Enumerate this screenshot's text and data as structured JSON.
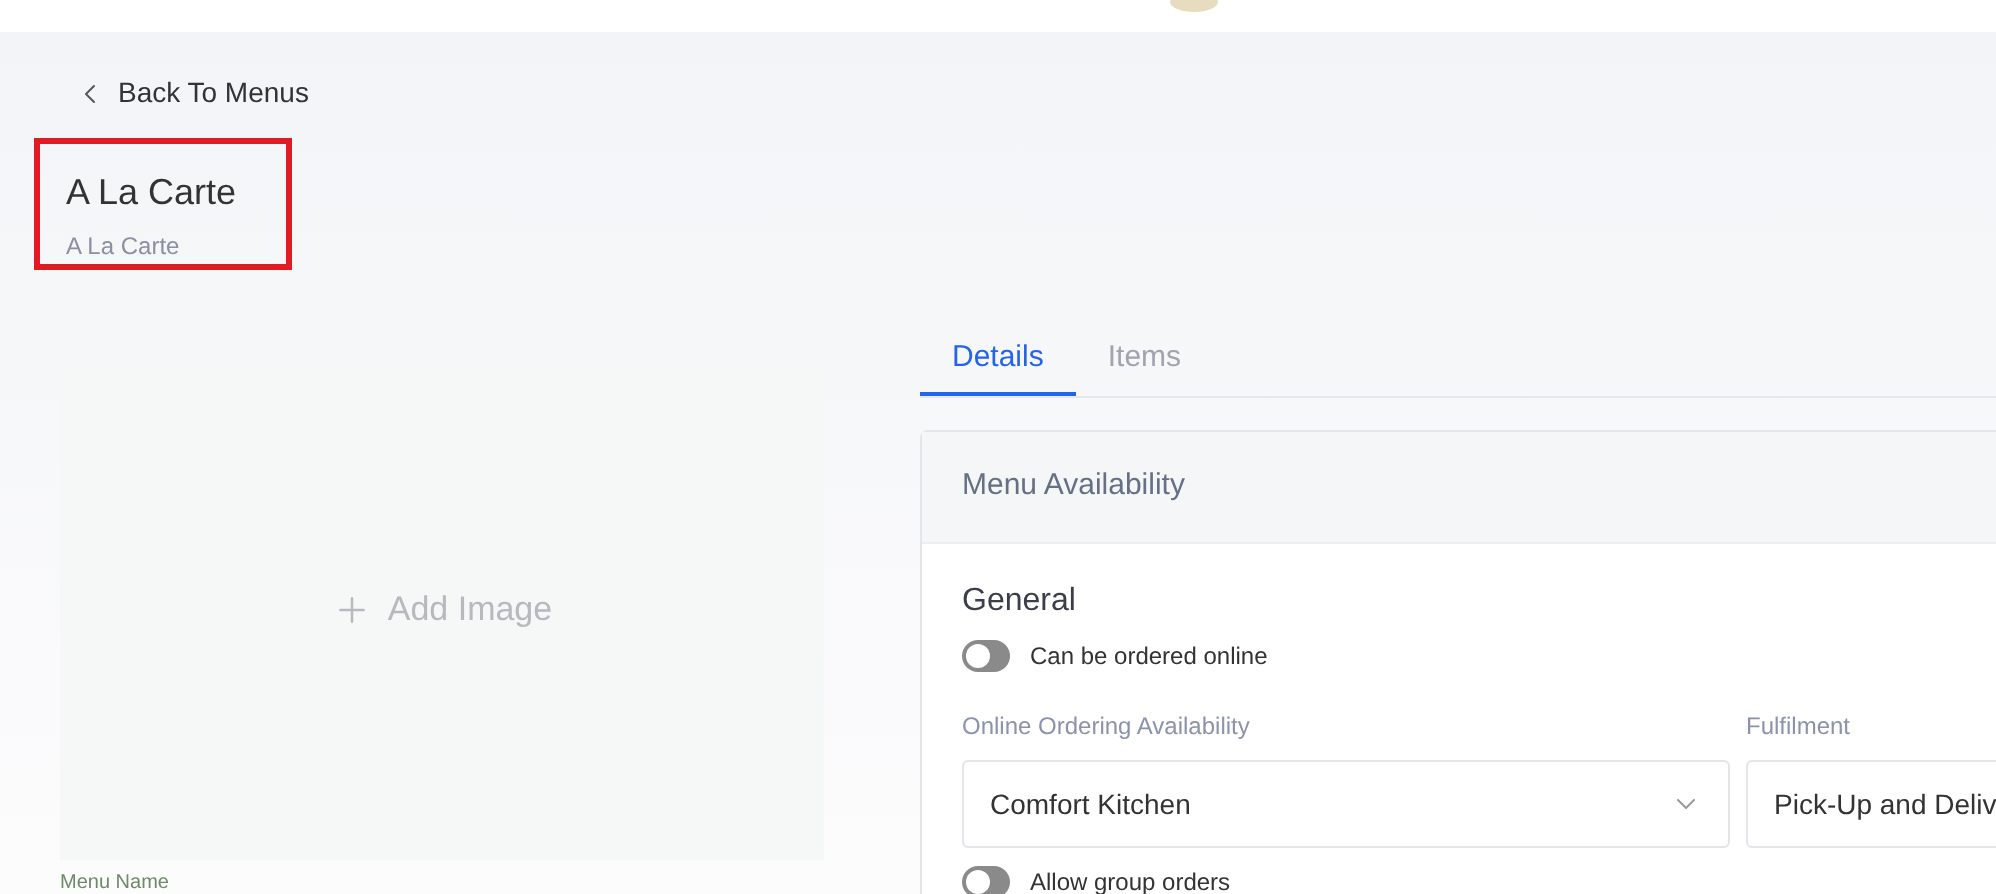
{
  "back_link": "Back To Menus",
  "header": {
    "title": "A La Carte",
    "subtitle": "A La Carte",
    "highlighted": true
  },
  "image_placeholder": "Add Image",
  "menu_name_label": "Menu Name",
  "tabs": [
    {
      "label": "Details",
      "selected": true
    },
    {
      "label": "Items",
      "selected": false
    }
  ],
  "card": {
    "title": "Menu Availability",
    "section": "General",
    "toggles_top": [
      {
        "label": "Can be ordered online",
        "on": false
      }
    ],
    "fields": [
      {
        "label": "Online Ordering Availability",
        "value": "Comfort Kitchen",
        "kind": "dropdown"
      },
      {
        "label": "Fulfilment",
        "value": "Pick-Up and Deliv",
        "kind": "text"
      }
    ],
    "toggles_bottom": [
      {
        "label": "Allow group orders",
        "on": false
      }
    ]
  }
}
